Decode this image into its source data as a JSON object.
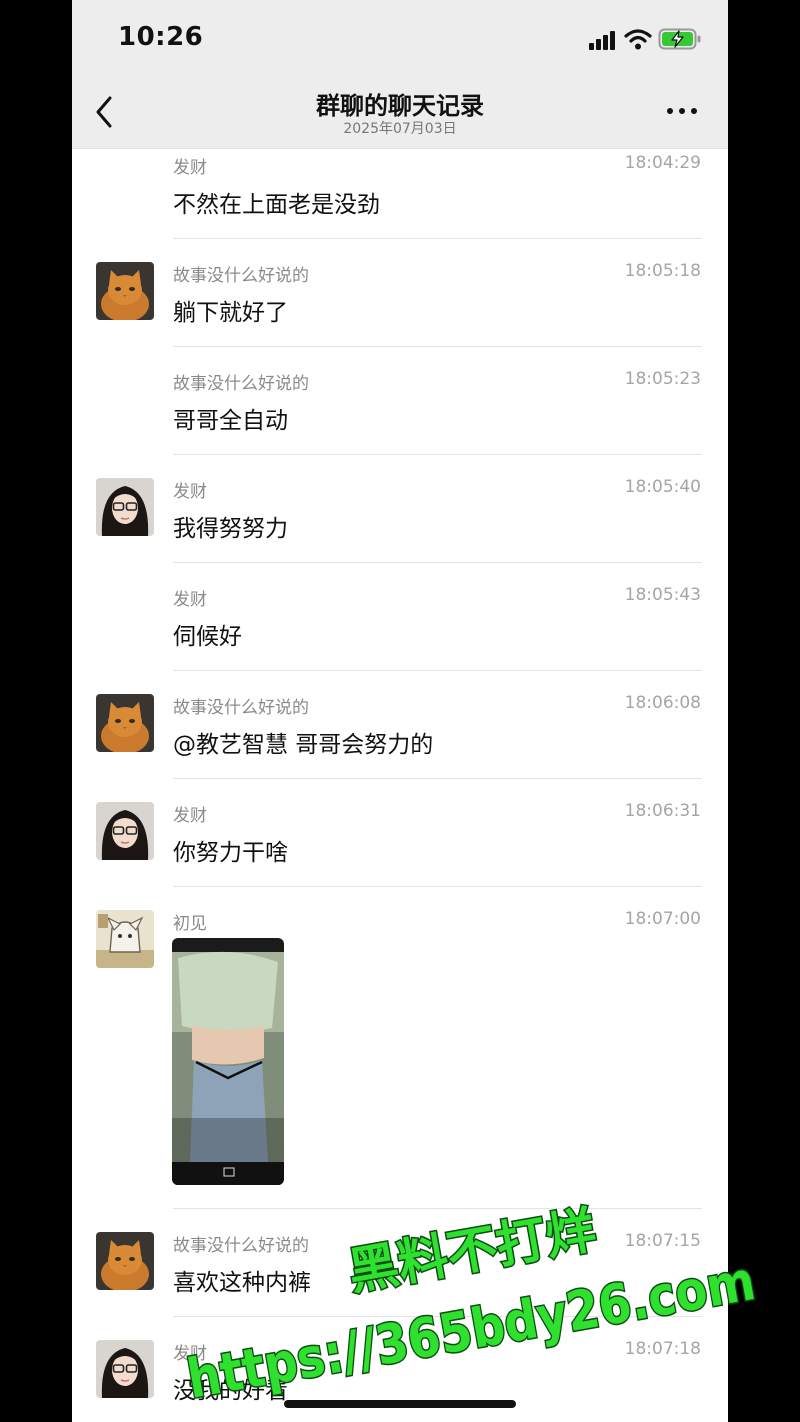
{
  "status": {
    "time": "10:26"
  },
  "header": {
    "title": "群聊的聊天记录",
    "subtitle": "2025年07月03日"
  },
  "messages": [
    {
      "sender": "发财",
      "time": "18:04:29",
      "text": "不然在上面老是没劲",
      "avatar": "girl-glasses-avatar"
    },
    {
      "sender": "故事没什么好说的",
      "time": "18:05:18",
      "text": "躺下就好了",
      "avatar": "orange-cat-avatar"
    },
    {
      "sender": "故事没什么好说的",
      "time": "18:05:23",
      "text": "哥哥全自动",
      "avatar": ""
    },
    {
      "sender": "发财",
      "time": "18:05:40",
      "text": "我得努努力",
      "avatar": "girl-glasses-avatar"
    },
    {
      "sender": "发财",
      "time": "18:05:43",
      "text": "伺候好",
      "avatar": ""
    },
    {
      "sender": "故事没什么好说的",
      "time": "18:06:08",
      "text": "@教艺智慧 哥哥会努力的",
      "avatar": "orange-cat-avatar"
    },
    {
      "sender": "发财",
      "time": "18:06:31",
      "text": "你努力干啥",
      "avatar": "girl-glasses-avatar"
    },
    {
      "sender": "初见",
      "time": "18:07:00",
      "text": "",
      "avatar": "anime-avatar",
      "image": "photo-message"
    },
    {
      "sender": "故事没什么好说的",
      "time": "18:07:15",
      "text": "喜欢这种内裤",
      "avatar": "orange-cat-avatar"
    },
    {
      "sender": "发财",
      "time": "18:07:18",
      "text": "没我的好看",
      "avatar": "girl-glasses-avatar"
    }
  ],
  "watermark": {
    "line1": "黑料不打烊",
    "line2": "https://365bdy26.com"
  },
  "colors": {
    "background": "#ffffff",
    "header": "#ededed",
    "watermark_fill": "#2fe02f",
    "watermark_outline": "#0b4d12"
  }
}
